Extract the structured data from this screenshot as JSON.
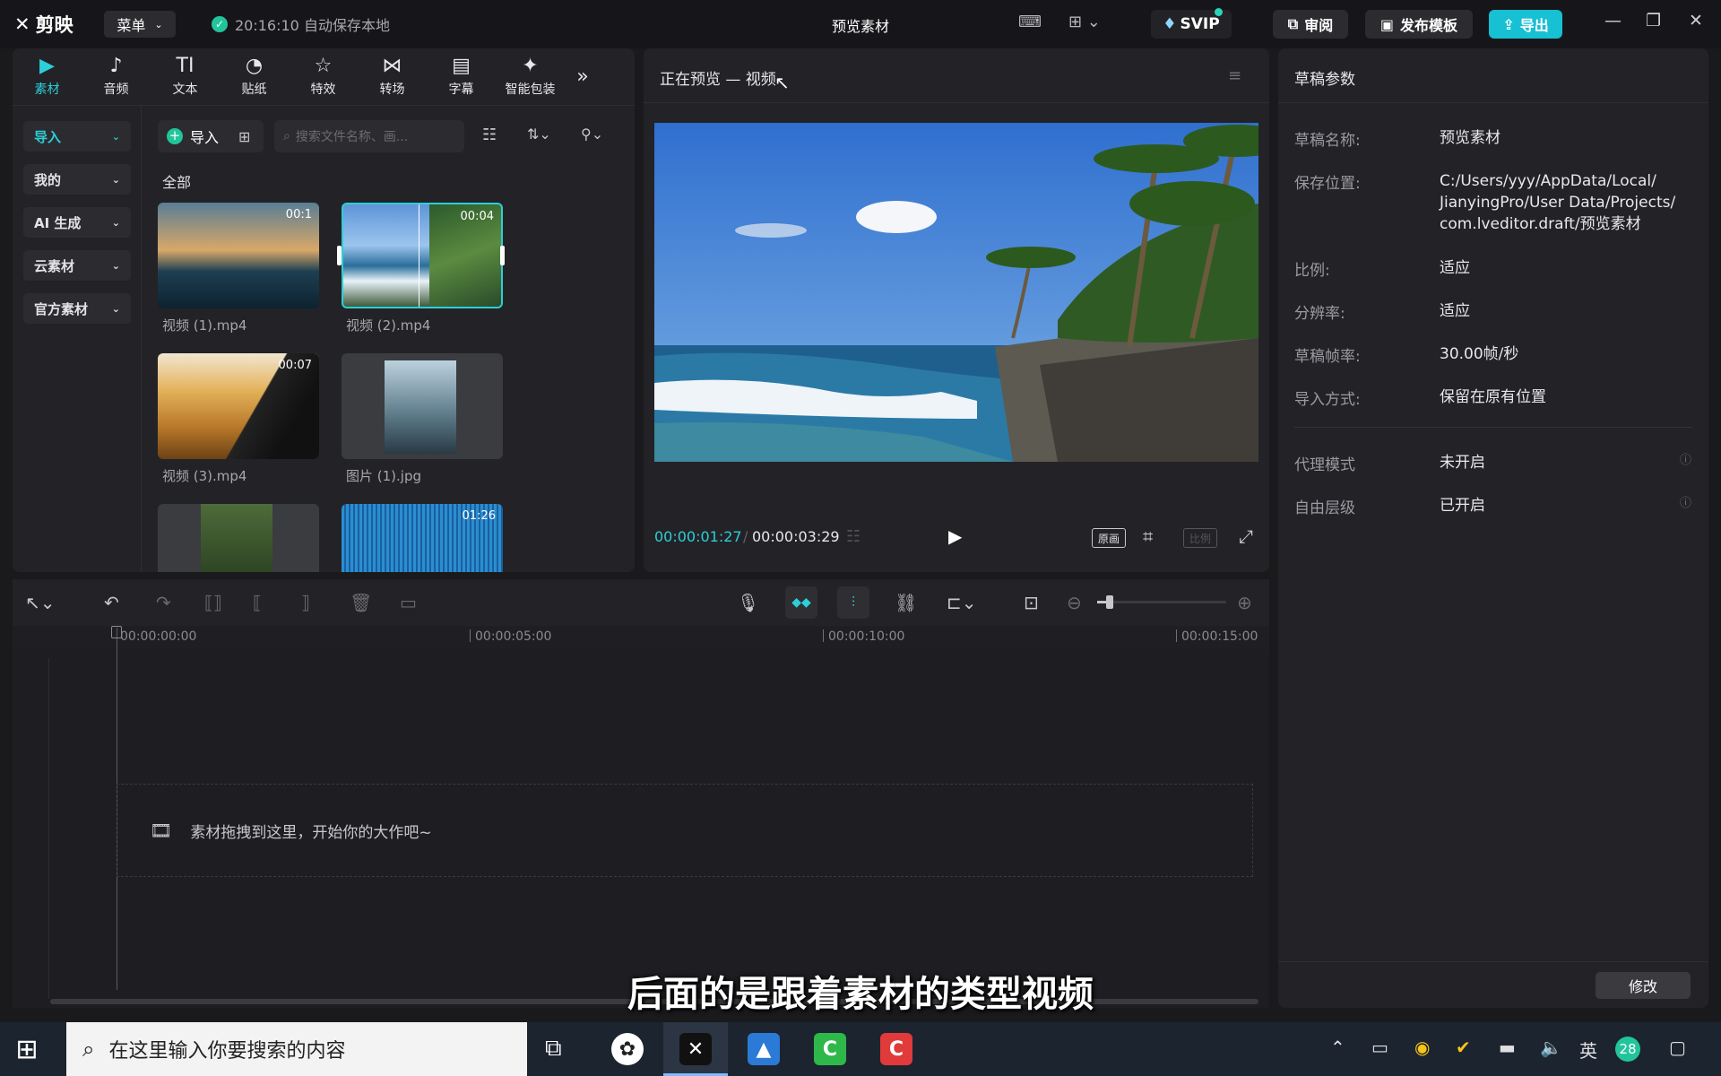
{
  "app": {
    "name": "剪映",
    "menu_label": "菜单",
    "autosave": "20:16:10 自动保存本地",
    "window_title": "预览素材"
  },
  "titlebar": {
    "svip": "SVIP",
    "review": "审阅",
    "publish_template": "发布模板",
    "export": "导出"
  },
  "tools": [
    {
      "icon": "material-icon",
      "glyph": "▶",
      "label": "素材"
    },
    {
      "icon": "audio-icon",
      "glyph": "♪",
      "label": "音频"
    },
    {
      "icon": "text-icon",
      "glyph": "TI",
      "label": "文本"
    },
    {
      "icon": "sticker-icon",
      "glyph": "◔",
      "label": "贴纸"
    },
    {
      "icon": "effects-icon",
      "glyph": "☆",
      "label": "特效"
    },
    {
      "icon": "transition-icon",
      "glyph": "⋈",
      "label": "转场"
    },
    {
      "icon": "caption-icon",
      "glyph": "▤",
      "label": "字幕"
    },
    {
      "icon": "smart-pack-icon",
      "glyph": "✦",
      "label": "智能包装"
    }
  ],
  "sidenav": [
    {
      "label": "导入",
      "active": true
    },
    {
      "label": "我的"
    },
    {
      "label": "AI 生成"
    },
    {
      "label": "云素材"
    },
    {
      "label": "官方素材"
    }
  ],
  "media": {
    "import_label": "导入",
    "search_placeholder": "搜索文件名称、画...",
    "section_label": "全部",
    "items": [
      {
        "name": "视频 (1).mp4",
        "duration": "00:1"
      },
      {
        "name": "视频 (2).mp4",
        "duration": "00:04"
      },
      {
        "name": "视频 (3).mp4",
        "duration": "00:07"
      },
      {
        "name": "图片 (1).jpg",
        "duration": ""
      },
      {
        "name": "",
        "duration": ""
      },
      {
        "name": "",
        "duration": "01:26"
      }
    ]
  },
  "preview": {
    "title": "正在预览 — 视频",
    "current_time": "00:00:01:27",
    "total_time": "00:00:03:29",
    "original_label": "原画",
    "ratio_label": "比例"
  },
  "timeline": {
    "ticks": [
      "00:00:00:00",
      "00:00:05:00",
      "00:00:10:00",
      "00:00:15:00"
    ],
    "drop_hint": "素材拖拽到这里，开始你的大作吧~",
    "zoom": 0.1
  },
  "params": {
    "title": "草稿参数",
    "rows": [
      {
        "label": "草稿名称:",
        "value": "预览素材"
      },
      {
        "label": "保存位置:",
        "value": "C:/Users/yyy/AppData/Local/ JianyingPro/User Data/Projects/ com.lveditor.draft/预览素材"
      },
      {
        "label": "比例:",
        "value": "适应"
      },
      {
        "label": "分辨率:",
        "value": "适应"
      },
      {
        "label": "草稿帧率:",
        "value": "30.00帧/秒"
      },
      {
        "label": "导入方式:",
        "value": "保留在原有位置"
      },
      {
        "label": "代理模式",
        "value": "未开启"
      },
      {
        "label": "自由层级",
        "value": "已开启"
      }
    ],
    "modify_label": "修改"
  },
  "subtitle": "后面的是跟着素材的类型视频",
  "taskbar": {
    "search_placeholder": "在这里输入你要搜索的内容",
    "ime": "英",
    "notification_count": "28"
  },
  "colors": {
    "accent": "#17c0d3",
    "active_tab": "#2ccfd8",
    "ok": "#22c59b"
  }
}
